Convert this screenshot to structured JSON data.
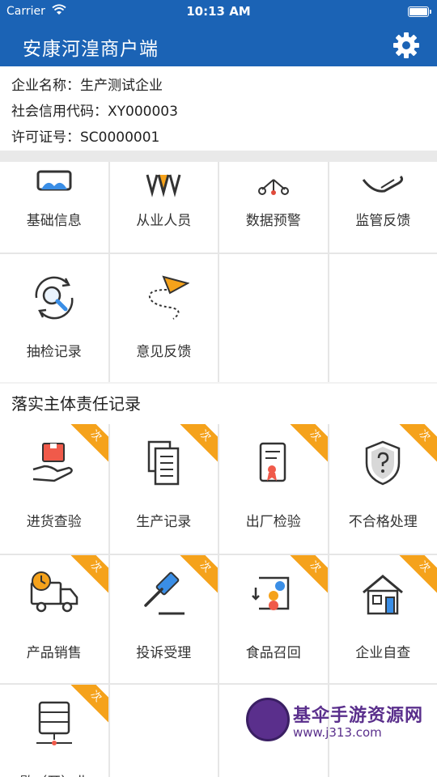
{
  "status_bar": {
    "carrier": "Carrier",
    "time": "10:13 AM"
  },
  "nav": {
    "title": "安康河湟商户端",
    "settings_icon": "gear-icon"
  },
  "company": {
    "name_row": "企业名称：生产测试企业",
    "credit_row": "社会信用代码：XY000003",
    "license_row": "许可证号：SC0000001"
  },
  "menu": {
    "basic_info": "基础信息",
    "staff": "从业人员",
    "data_warning": "数据预警",
    "supervision_feedback": "监管反馈",
    "inspection_records": "抽检记录",
    "opinion_feedback": "意见反馈"
  },
  "section": {
    "title": "落实主体责任记录"
  },
  "records": {
    "badge": "次",
    "purchase_check": "进货查验",
    "production_record": "生产记录",
    "factory_inspection": "出厂检验",
    "nonconforming": "不合格处理",
    "product_sales": "产品销售",
    "complaint": "投诉受理",
    "food_recall": "食品召回",
    "self_inspection": "企业自查",
    "suspension": "歇（开）业"
  },
  "watermark": {
    "title": "基伞手游资源网",
    "url": "www.j313.com"
  },
  "colors": {
    "primary": "#1b63b5",
    "badge": "#f5a21b",
    "icon_orange": "#f08a2c",
    "icon_blue": "#3a8ee6",
    "icon_dark": "#333333"
  }
}
